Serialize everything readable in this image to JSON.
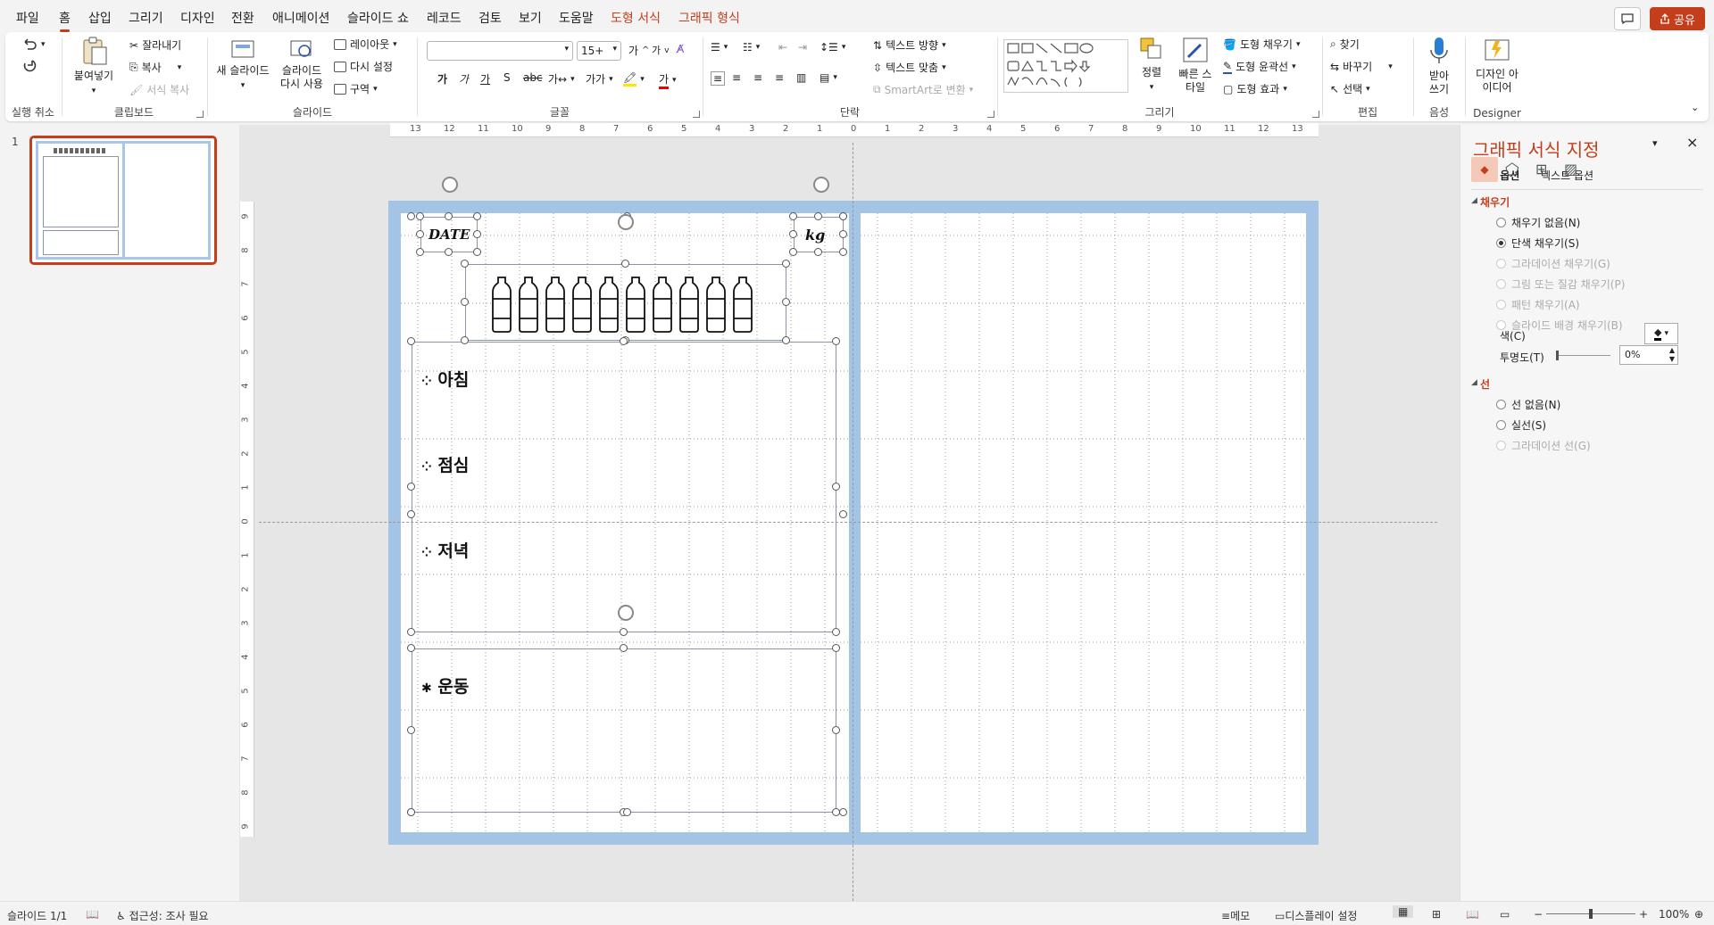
{
  "menu": {
    "tabs": [
      "파일",
      "홈",
      "삽입",
      "그리기",
      "디자인",
      "전환",
      "애니메이션",
      "슬라이드 쇼",
      "레코드",
      "검토",
      "보기",
      "도움말",
      "도형 서식",
      "그래픽 형식"
    ],
    "active_tab": "홈",
    "share_label": "공유"
  },
  "ribbon": {
    "undo": {
      "label": "실행 취소"
    },
    "clipboard": {
      "label": "클립보드",
      "paste": "붙여넣기",
      "cut": "잘라내기",
      "copy": "복사",
      "format_painter": "서식 복사"
    },
    "slides": {
      "label": "슬라이드",
      "new_slide": "새 슬라이드",
      "reuse": "슬라이드 다시 사용",
      "layout": "레이아웃",
      "reset": "다시 설정",
      "section": "구역"
    },
    "font": {
      "label": "글꼴",
      "font_name": "",
      "font_size": "15+"
    },
    "paragraph": {
      "label": "단락",
      "text_direction": "텍스트 방향",
      "align_text": "텍스트 맞춤",
      "smartart": "SmartArt로 변환"
    },
    "drawing": {
      "label": "그리기",
      "arrange": "정렬",
      "quick_styles": "빠른 스타일",
      "shape_fill": "도형 채우기",
      "shape_outline": "도형 윤곽선",
      "shape_effects": "도형 효과"
    },
    "editing": {
      "label": "편집",
      "find": "찾기",
      "replace": "바꾸기",
      "select": "선택"
    },
    "voice": {
      "label": "음성",
      "dictate": "받아 쓰기"
    },
    "designer": {
      "label": "Designer",
      "design_ideas": "디자인 아이디어"
    }
  },
  "thumbnails": {
    "slide_number": "1"
  },
  "slide": {
    "date_label": "DATE",
    "kg_label": "kg",
    "bottle_count": 10,
    "meals": [
      {
        "bullet": "⁘",
        "label": "아침"
      },
      {
        "bullet": "⁘",
        "label": "점심"
      },
      {
        "bullet": "⁘",
        "label": "저녁"
      }
    ],
    "exercise": {
      "bullet": "✱",
      "label": "운동"
    }
  },
  "format_pane": {
    "title": "그래픽 서식 지정",
    "tabs": [
      "도형 옵션",
      "텍스트 옵션"
    ],
    "fill": {
      "section": "채우기",
      "options": [
        {
          "label": "채우기 없음(N)",
          "selected": false,
          "enabled": true
        },
        {
          "label": "단색 채우기(S)",
          "selected": true,
          "enabled": true
        },
        {
          "label": "그라데이션 채우기(G)",
          "selected": false,
          "enabled": false
        },
        {
          "label": "그림 또는 질감 채우기(P)",
          "selected": false,
          "enabled": false
        },
        {
          "label": "패턴 채우기(A)",
          "selected": false,
          "enabled": false
        },
        {
          "label": "슬라이드 배경 채우기(B)",
          "selected": false,
          "enabled": false
        }
      ],
      "color_label": "색(C)",
      "transparency_label": "투명도(T)",
      "transparency_value": "0%"
    },
    "line": {
      "section": "선",
      "options": [
        {
          "label": "선 없음(N)",
          "selected": false,
          "enabled": true
        },
        {
          "label": "실선(S)",
          "selected": false,
          "enabled": true
        },
        {
          "label": "그라데이션 선(G)",
          "selected": false,
          "enabled": false
        }
      ]
    }
  },
  "status": {
    "slide_info": "슬라이드 1/1",
    "accessibility": "접근성: 조사 필요",
    "notes": "메모",
    "display_settings": "디스플레이 설정",
    "zoom": "100%"
  },
  "colors": {
    "accent": "#c43e1c",
    "slide_bg": "#a4c4e6"
  }
}
